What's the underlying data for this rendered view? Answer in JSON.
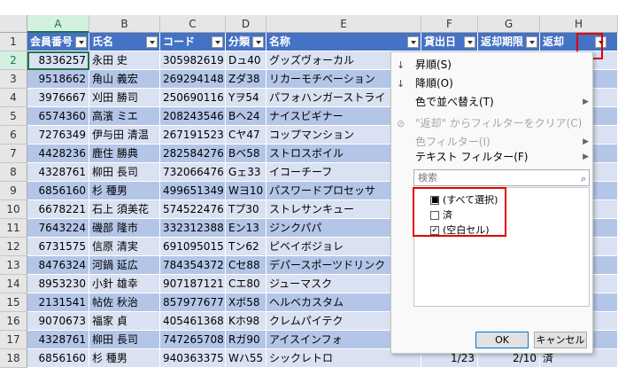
{
  "columns": [
    "A",
    "B",
    "C",
    "D",
    "E",
    "F",
    "G",
    "H"
  ],
  "header_row": {
    "row": "1",
    "cells": [
      "会員番号",
      "氏名",
      "コード",
      "分類",
      "名称",
      "貸出日",
      "返却期限",
      "返却"
    ]
  },
  "rows": [
    {
      "r": "2",
      "a": "8336257",
      "b": "永田 史",
      "c": "305982619",
      "d": "Dュ40",
      "e": "グッズヴォーカル",
      "f": "",
      "g": "",
      "h": ""
    },
    {
      "r": "3",
      "a": "9518662",
      "b": "角山 義宏",
      "c": "269294148",
      "d": "Zダ38",
      "e": "リカーモチベーション",
      "f": "",
      "g": "",
      "h": ""
    },
    {
      "r": "4",
      "a": "3976667",
      "b": "刈田 勝司",
      "c": "250690116",
      "d": "Yヲ54",
      "e": "パフォハンガーストライ",
      "f": "",
      "g": "",
      "h": ""
    },
    {
      "r": "5",
      "a": "6574360",
      "b": "高濱 ミエ",
      "c": "208243546",
      "d": "Bヘ24",
      "e": "ナイスビギナー",
      "f": "",
      "g": "",
      "h": ""
    },
    {
      "r": "6",
      "a": "7276349",
      "b": "伊与田 清温",
      "c": "267191523",
      "d": "Cヤ47",
      "e": "コップマンション",
      "f": "",
      "g": "",
      "h": ""
    },
    {
      "r": "7",
      "a": "4428236",
      "b": "鹿住 勝典",
      "c": "282584276",
      "d": "Bベ58",
      "e": "ストロスボイル",
      "f": "",
      "g": "",
      "h": ""
    },
    {
      "r": "8",
      "a": "4328761",
      "b": "柳田 長司",
      "c": "732066476",
      "d": "Gェ33",
      "e": "イコーチーフ",
      "f": "",
      "g": "",
      "h": ""
    },
    {
      "r": "9",
      "a": "6856160",
      "b": "杉 種男",
      "c": "499651349",
      "d": "Wヨ10",
      "e": "パスワードプロセッサ",
      "f": "",
      "g": "",
      "h": ""
    },
    {
      "r": "10",
      "a": "6678221",
      "b": "石上 須美花",
      "c": "574522476",
      "d": "Tプ30",
      "e": "ストレサンキュー",
      "f": "",
      "g": "",
      "h": ""
    },
    {
      "r": "11",
      "a": "7643224",
      "b": "磯部 隆市",
      "c": "332312388",
      "d": "Eン13",
      "e": "ジンクパパ",
      "f": "",
      "g": "",
      "h": ""
    },
    {
      "r": "12",
      "a": "6731575",
      "b": "信原 清実",
      "c": "691095015",
      "d": "Tン62",
      "e": "ピベイボジョレ",
      "f": "",
      "g": "",
      "h": ""
    },
    {
      "r": "13",
      "a": "8476324",
      "b": "河鍋 延広",
      "c": "784354372",
      "d": "Cセ88",
      "e": "デパースポーツドリンク",
      "f": "",
      "g": "",
      "h": ""
    },
    {
      "r": "14",
      "a": "8953230",
      "b": "小針 雄幸",
      "c": "907187121",
      "d": "Cエ80",
      "e": "ジューマスク",
      "f": "",
      "g": "",
      "h": ""
    },
    {
      "r": "15",
      "a": "2131541",
      "b": "帖佐 秋治",
      "c": "857977677",
      "d": "Xボ58",
      "e": "ヘルベカスタム",
      "f": "",
      "g": "",
      "h": ""
    },
    {
      "r": "16",
      "a": "9070673",
      "b": "福家 貞",
      "c": "405461368",
      "d": "Kホ98",
      "e": "クレムパイテク",
      "f": "",
      "g": "",
      "h": ""
    },
    {
      "r": "17",
      "a": "4328761",
      "b": "柳田 長司",
      "c": "747265708",
      "d": "Rガ90",
      "e": "アイスインフォ",
      "f": "",
      "g": "",
      "h": ""
    },
    {
      "r": "18",
      "a": "6856160",
      "b": "杉 種男",
      "c": "940363375",
      "d": "Wハ55",
      "e": "シックレトロ",
      "f": "1/23",
      "g": "2/10",
      "h": "済"
    }
  ],
  "filter_menu": {
    "sort_asc": "昇順(S)",
    "sort_desc": "降順(O)",
    "sort_color": "色で並べ替え(T)",
    "clear_filter": "\"返却\" からフィルターをクリア(C)",
    "color_filter": "色フィルター(I)",
    "text_filter": "テキスト フィルター(F)",
    "search_placeholder": "検索",
    "items": [
      {
        "label": "(すべて選択)",
        "state": "■"
      },
      {
        "label": "済",
        "state": ""
      },
      {
        "label": "(空白セル)",
        "state": "✓"
      }
    ],
    "ok": "OK",
    "cancel": "キャンセル"
  },
  "colors": {
    "header": "#4472c4",
    "band_dark": "#b4c6e7",
    "band_light": "#d9e1f2",
    "highlight": "#e00000"
  }
}
